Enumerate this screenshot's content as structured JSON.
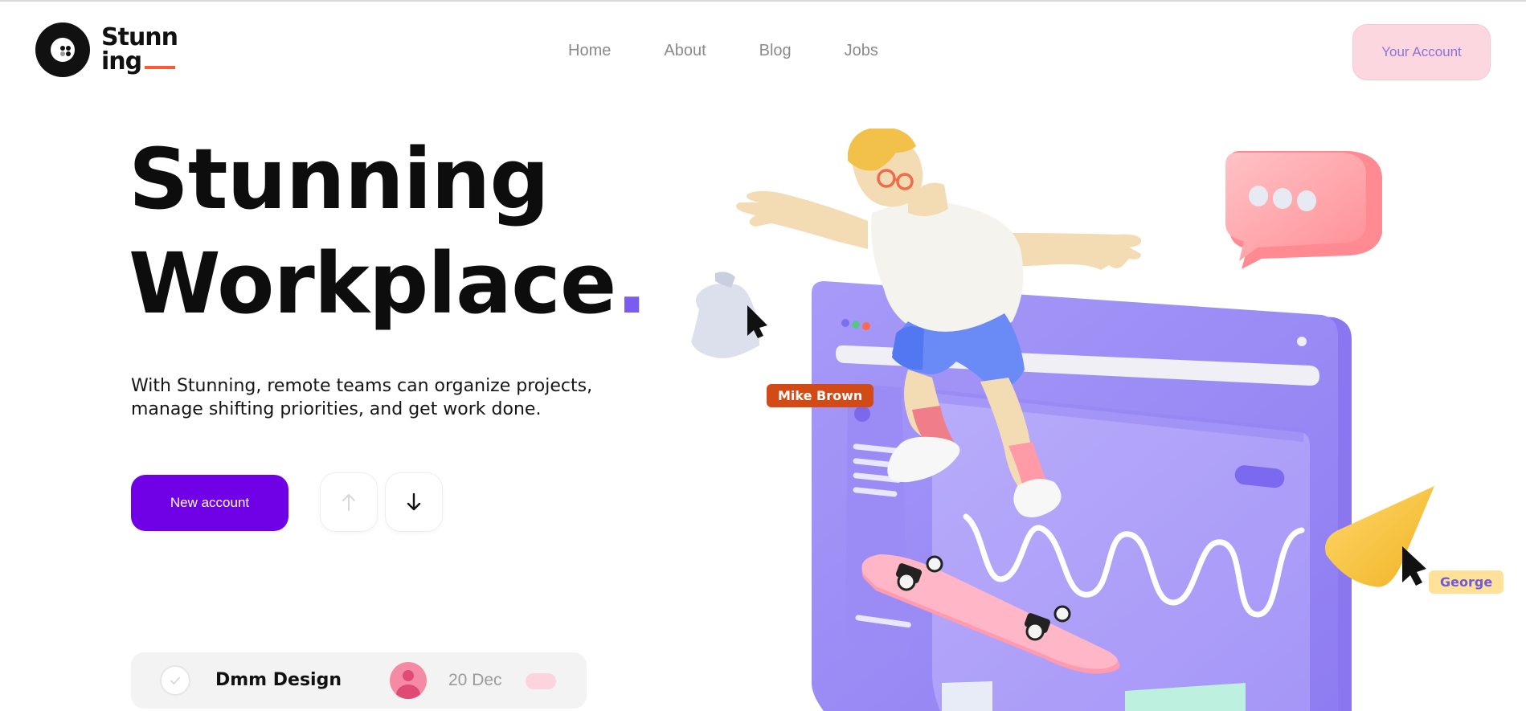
{
  "logo": {
    "line1": "Stunn",
    "line2": "ing"
  },
  "nav": {
    "items": [
      {
        "label": "Home"
      },
      {
        "label": "About"
      },
      {
        "label": "Blog"
      },
      {
        "label": "Jobs"
      }
    ],
    "account_button": "Your Account"
  },
  "hero": {
    "title_line1": "Stunning",
    "title_line2": "Workplace",
    "title_period": ".",
    "description": "With Stunning, remote teams can organize projects, manage shifting priorities, and get work done.",
    "primary_button": "New account"
  },
  "illustration": {
    "tags": {
      "left": "Mike Brown",
      "right": "George"
    }
  },
  "task_card": {
    "title": "Dmm Design",
    "date": "20 Dec"
  },
  "colors": {
    "accent": "#7000e6",
    "accent_light": "#7a5cf0",
    "pink": "#fdd7e0",
    "orange": "#ff5a36"
  },
  "icons": [
    "logo-mark",
    "arrow-up-icon",
    "arrow-down-icon",
    "check-icon",
    "avatar",
    "bell-icon",
    "chat-bubble-icon",
    "cursor-icon"
  ]
}
